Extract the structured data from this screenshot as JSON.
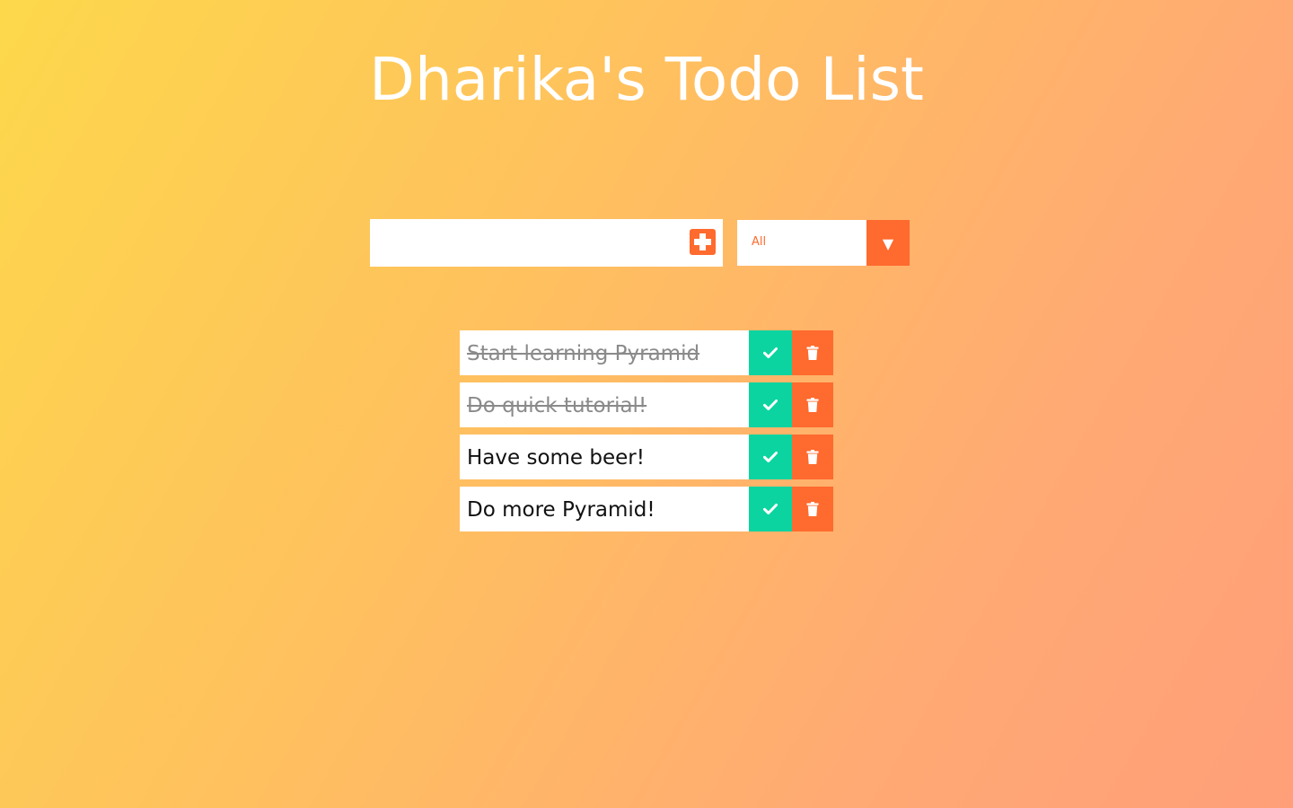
{
  "header": {
    "title": "Dharika's Todo List"
  },
  "add_form": {
    "input_value": "",
    "input_placeholder": "",
    "add_icon": "plus-square-icon"
  },
  "filter": {
    "selected": "All",
    "arrow_glyph": "▼"
  },
  "todos": [
    {
      "text": "Start learning Pyramid",
      "completed": true
    },
    {
      "text": "Do quick tutorial!",
      "completed": true
    },
    {
      "text": "Have some beer!",
      "completed": false
    },
    {
      "text": "Do more Pyramid!",
      "completed": false
    }
  ],
  "colors": {
    "accent": "#ff6a2e",
    "complete": "#0bd4a0",
    "background_start": "#fdd84b",
    "background_end": "#ff9f79"
  },
  "icons": {
    "complete": "check-icon",
    "delete": "trash-icon"
  }
}
